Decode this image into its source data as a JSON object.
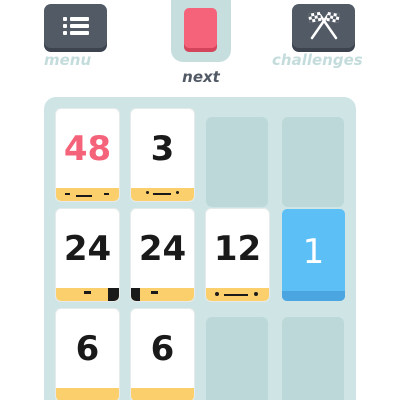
{
  "header": {
    "menu_label": "menu",
    "next_label": "next",
    "challenges_label": "challenges",
    "menu_icon": "list-icon",
    "challenges_icon": "crossed-flags-icon",
    "next_card_color": "#f5637a"
  },
  "board": {
    "rows": [
      [
        {
          "value": "48",
          "color": "red"
        },
        {
          "value": "3",
          "color": "white"
        },
        null,
        null
      ],
      [
        {
          "value": "24",
          "color": "white"
        },
        {
          "value": "24",
          "color": "white"
        },
        {
          "value": "12",
          "color": "white"
        },
        {
          "value": "1",
          "color": "blue"
        }
      ],
      [
        {
          "value": "6",
          "color": "white"
        },
        {
          "value": "6",
          "color": "white"
        },
        null,
        null
      ]
    ]
  },
  "colors": {
    "button_bg": "#525a65",
    "label_light": "#c4dcdc",
    "label_dark": "#525a65",
    "board_bg": "#cfe5e5",
    "slot_bg": "#bcd8d8",
    "card_white": "#ffffff",
    "card_foot": "#fbcf6c",
    "card_blue": "#5cbff5",
    "number_red": "#f5637a",
    "number_dark": "#1a1a1a"
  }
}
